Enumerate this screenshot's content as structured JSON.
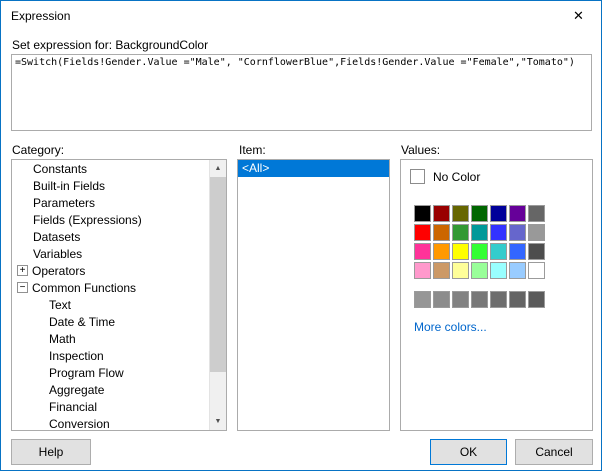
{
  "window": {
    "title": "Expression"
  },
  "icons": {
    "close": "✕",
    "scroll_up": "▲",
    "scroll_down": "▼",
    "expand": "+",
    "collapse": "−"
  },
  "expression": {
    "label": "Set expression for: BackgroundColor",
    "value": "=Switch(Fields!Gender.Value =\"Male\", \"CornflowerBlue\",Fields!Gender.Value =\"Female\",\"Tomato\")"
  },
  "category": {
    "label": "Category:",
    "items": [
      {
        "label": "Constants",
        "indent": 1
      },
      {
        "label": "Built-in Fields",
        "indent": 1
      },
      {
        "label": "Parameters",
        "indent": 1
      },
      {
        "label": "Fields (Expressions)",
        "indent": 1
      },
      {
        "label": "Datasets",
        "indent": 1
      },
      {
        "label": "Variables",
        "indent": 1
      },
      {
        "label": "Operators",
        "indent": 0,
        "expander": "expand"
      },
      {
        "label": "Common Functions",
        "indent": 0,
        "expander": "collapse"
      },
      {
        "label": "Text",
        "indent": 2
      },
      {
        "label": "Date & Time",
        "indent": 2
      },
      {
        "label": "Math",
        "indent": 2
      },
      {
        "label": "Inspection",
        "indent": 2
      },
      {
        "label": "Program Flow",
        "indent": 2
      },
      {
        "label": "Aggregate",
        "indent": 2
      },
      {
        "label": "Financial",
        "indent": 2
      },
      {
        "label": "Conversion",
        "indent": 2
      }
    ]
  },
  "item": {
    "label": "Item:",
    "items": [
      {
        "label": "<All>",
        "selected": true
      }
    ]
  },
  "values": {
    "label": "Values:",
    "no_color_label": "No Color",
    "no_color_swatch": "#FFFFFF",
    "palette": [
      [
        "#000000",
        "#990000",
        "#666600",
        "#006600",
        "#000099",
        "#660099",
        "#666666"
      ],
      [
        "#FF0000",
        "#CC6600",
        "#339933",
        "#009999",
        "#3333FF",
        "#6666CC",
        "#999999"
      ],
      [
        "#FF3399",
        "#FF9900",
        "#FFFF00",
        "#33FF33",
        "#33CCCC",
        "#3366FF",
        "#4D4D4D"
      ],
      [
        "#FF99CC",
        "#CC9966",
        "#FFFF99",
        "#99FF99",
        "#99FFFF",
        "#99CCFF",
        "#FFFFFF"
      ]
    ],
    "grays": [
      "#969696",
      "#8C8C8C",
      "#828282",
      "#787878",
      "#6E6E6E",
      "#646464",
      "#5A5A5A"
    ],
    "more_colors_label": "More colors..."
  },
  "buttons": {
    "help": "Help",
    "ok": "OK",
    "cancel": "Cancel"
  },
  "colors": {
    "accent": "#0078D7",
    "selection": "#0078D7",
    "link": "#0066CC",
    "panel_border": "#ABABAB",
    "button_bg": "#E1E1E1",
    "window_border": "#0873C4"
  }
}
